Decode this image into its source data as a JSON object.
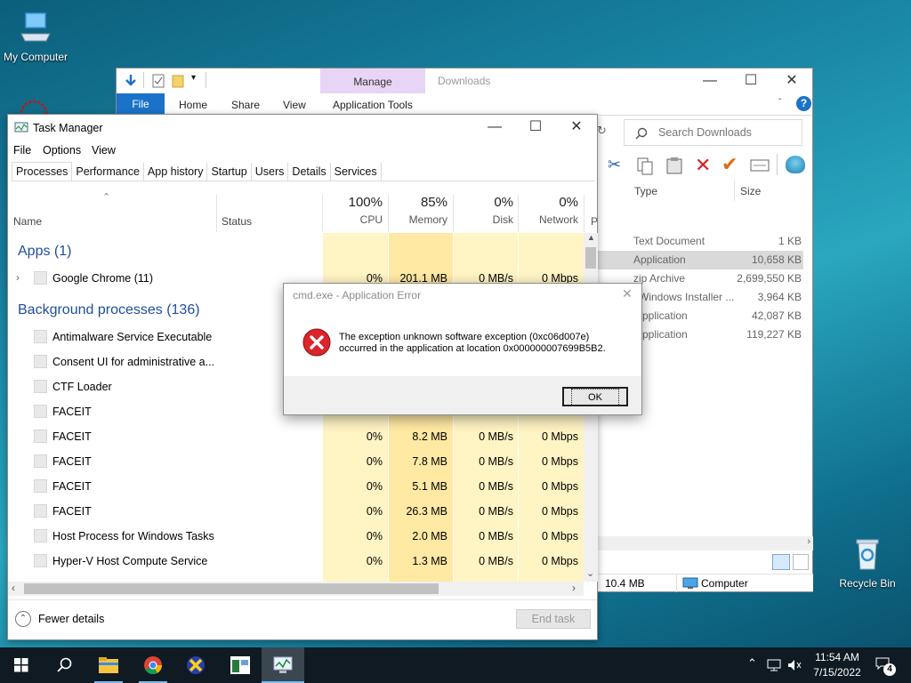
{
  "desktop": {
    "my_computer_label": "My Computer",
    "recycle_bin_label": "Recycle Bin"
  },
  "explorer": {
    "title": "Downloads",
    "manage_label": "Manage",
    "tabs": [
      "File",
      "Home",
      "Share",
      "View"
    ],
    "app_tools_label": "Application Tools",
    "search_placeholder": "Search Downloads",
    "columns": {
      "type": "Type",
      "size": "Size"
    },
    "rows": [
      {
        "type": "Text Document",
        "size": "1 KB"
      },
      {
        "type": "Application",
        "size": "10,658 KB"
      },
      {
        "type": "zip Archive",
        "size": "2,699,550 KB"
      },
      {
        "type": "Windows Installer ...",
        "size": "3,964 KB"
      },
      {
        "type": "pplication",
        "size": "42,087 KB"
      },
      {
        "type": "pplication",
        "size": "119,227 KB"
      }
    ],
    "status_size": "10.4 MB",
    "status_location": "Computer"
  },
  "taskmgr": {
    "title": "Task Manager",
    "menu": [
      "File",
      "Options",
      "View"
    ],
    "tabs": [
      "Processes",
      "Performance",
      "App history",
      "Startup",
      "Users",
      "Details",
      "Services"
    ],
    "columns": {
      "name": "Name",
      "status": "Status",
      "cpu_pct": "100%",
      "cpu": "CPU",
      "mem_pct": "85%",
      "mem": "Memory",
      "disk_pct": "0%",
      "disk": "Disk",
      "net_pct": "0%",
      "net": "Network",
      "p": "P"
    },
    "apps_header": "Apps (1)",
    "bg_header": "Background processes (136)",
    "apps": [
      {
        "name": "Google Chrome (11)",
        "cpu": "0%",
        "mem": "201.1 MB",
        "disk": "0 MB/s",
        "net": "0 Mbps"
      }
    ],
    "processes": [
      {
        "name": "Antimalware Service Executable",
        "cpu": "",
        "mem": "",
        "disk": "",
        "net": ""
      },
      {
        "name": "Consent UI for administrative a...",
        "cpu": "",
        "mem": "",
        "disk": "",
        "net": ""
      },
      {
        "name": "CTF Loader",
        "cpu": "",
        "mem": "",
        "disk": "",
        "net": ""
      },
      {
        "name": "FACEIT",
        "cpu": "",
        "mem": "",
        "disk": "",
        "net": ""
      },
      {
        "name": "FACEIT",
        "cpu": "0%",
        "mem": "8.2 MB",
        "disk": "0 MB/s",
        "net": "0 Mbps"
      },
      {
        "name": "FACEIT",
        "cpu": "0%",
        "mem": "7.8 MB",
        "disk": "0 MB/s",
        "net": "0 Mbps"
      },
      {
        "name": "FACEIT",
        "cpu": "0%",
        "mem": "5.1 MB",
        "disk": "0 MB/s",
        "net": "0 Mbps"
      },
      {
        "name": "FACEIT",
        "cpu": "0%",
        "mem": "26.3 MB",
        "disk": "0 MB/s",
        "net": "0 Mbps"
      },
      {
        "name": "Host Process for Windows Tasks",
        "cpu": "0%",
        "mem": "2.0 MB",
        "disk": "0 MB/s",
        "net": "0 Mbps"
      },
      {
        "name": "Hyper-V Host Compute Service",
        "cpu": "0%",
        "mem": "1.3 MB",
        "disk": "0 MB/s",
        "net": "0 Mbps"
      }
    ],
    "fewer_details": "Fewer details",
    "end_task": "End task"
  },
  "error_dialog": {
    "title": "cmd.exe - Application Error",
    "message_line1": "The exception unknown software exception (0xc06d007e)",
    "message_line2": "occurred in the application at location 0x000000007699B5B2.",
    "ok_label": "OK"
  },
  "taskbar": {
    "time": "11:54 AM",
    "date": "7/15/2022",
    "notification_count": "4"
  },
  "colors": {
    "accent": "#1e4e9c",
    "heat_light": "#fff4c4",
    "heat_mid": "#ffe9a3",
    "error_red": "#d9252b"
  }
}
